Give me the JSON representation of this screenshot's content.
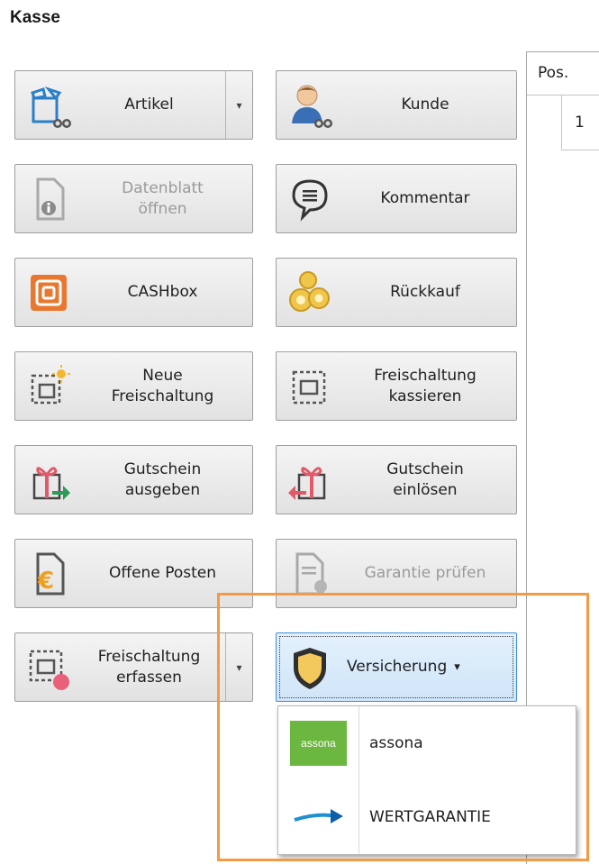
{
  "window": {
    "title": "Kasse"
  },
  "buttons": {
    "artikel": "Artikel",
    "kunde": "Kunde",
    "datenblatt": "Datenblatt\nöffnen",
    "kommentar": "Kommentar",
    "cashbox": "CASHbox",
    "rueckkauf": "Rückkauf",
    "neue_freischaltung": "Neue\nFreischaltung",
    "freischaltung_kassieren": "Freischaltung\nkassieren",
    "gutschein_ausgeben": "Gutschein\nausgeben",
    "gutschein_einloesen": "Gutschein\neinlösen",
    "offene_posten": "Offene Posten",
    "garantie_pruefen": "Garantie prüfen",
    "freischaltung_erfassen": "Freischaltung\nerfassen",
    "versicherung": "Versicherung",
    "dropdown_arrow": "▾"
  },
  "grid": {
    "header": "Pos.",
    "rows": [
      "1"
    ]
  },
  "menu": {
    "items": [
      {
        "label": "assona",
        "logo_text": "assona"
      },
      {
        "label": "WERTGARANTIE"
      }
    ]
  },
  "colors": {
    "highlight_border": "#f39a44",
    "active_button": "#cfe5f8",
    "assona_green": "#6cb73f"
  }
}
